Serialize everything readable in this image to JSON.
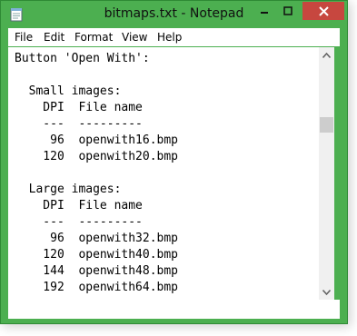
{
  "window": {
    "title": "bitmaps.txt - Notepad",
    "colors": {
      "frame": "#4caf50",
      "close": "#c7473f"
    }
  },
  "menu": [
    "File",
    "Edit",
    "Format",
    "View",
    "Help"
  ],
  "content": {
    "lines": [
      "Button 'Open With':",
      "",
      "  Small images:",
      "    DPI  File name",
      "    ---  ---------",
      "     96  openwith16.bmp",
      "    120  openwith20.bmp",
      "",
      "  Large images:",
      "    DPI  File name",
      "    ---  ---------",
      "     96  openwith32.bmp",
      "    120  openwith40.bmp",
      "    144  openwith48.bmp",
      "    192  openwith64.bmp"
    ]
  },
  "icons": {
    "app": "notepad-icon",
    "minimize": "minimize-icon",
    "maximize": "maximize-icon",
    "close": "close-icon",
    "scroll_up": "scroll-up-arrow-icon",
    "scroll_down": "scroll-down-arrow-icon"
  }
}
